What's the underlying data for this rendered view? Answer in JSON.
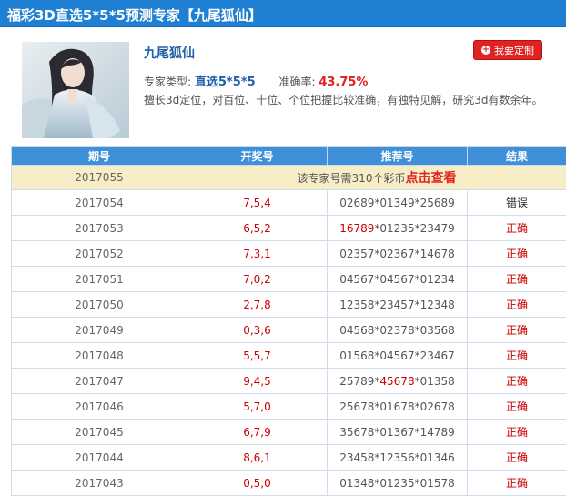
{
  "header": {
    "title": "福彩3D直选5*5*5预测专家【九尾狐仙】"
  },
  "expert": {
    "name": "九尾狐仙",
    "custom_button": "我要定制",
    "type_label": "专家类型:",
    "type_value": "直选5*5*5",
    "accuracy_label": "准确率:",
    "accuracy_value": "43.75%",
    "description": "擅长3d定位，对百位、十位、个位把握比较准确，有独特见解，研究3d有数余年。"
  },
  "table": {
    "headers": [
      "期号",
      "开奖号",
      "推荐号",
      "结果"
    ],
    "locked": {
      "period": "2017055",
      "text": "该专家号需310个彩币",
      "link": "点击查看"
    },
    "rows": [
      {
        "period": "2017054",
        "draw": "7,5,4",
        "rec": [
          {
            "t": "02689",
            "r": false
          },
          {
            "t": "*",
            "r": false
          },
          {
            "t": "01349",
            "r": false
          },
          {
            "t": "*",
            "r": false
          },
          {
            "t": "25689",
            "r": false
          }
        ],
        "result": "错误",
        "ok": false
      },
      {
        "period": "2017053",
        "draw": "6,5,2",
        "rec": [
          {
            "t": "16789",
            "r": true
          },
          {
            "t": "*",
            "r": false
          },
          {
            "t": "01235",
            "r": false
          },
          {
            "t": "*",
            "r": false
          },
          {
            "t": "23479",
            "r": false
          }
        ],
        "result": "正确",
        "ok": true
      },
      {
        "period": "2017052",
        "draw": "7,3,1",
        "rec": [
          {
            "t": "02357",
            "r": false
          },
          {
            "t": "*",
            "r": false
          },
          {
            "t": "02367",
            "r": false
          },
          {
            "t": "*",
            "r": false
          },
          {
            "t": "14678",
            "r": false
          }
        ],
        "result": "正确",
        "ok": true
      },
      {
        "period": "2017051",
        "draw": "7,0,2",
        "rec": [
          {
            "t": "04567",
            "r": false
          },
          {
            "t": "*",
            "r": false
          },
          {
            "t": "04567",
            "r": false
          },
          {
            "t": "*",
            "r": false
          },
          {
            "t": "01234",
            "r": false
          }
        ],
        "result": "正确",
        "ok": true
      },
      {
        "period": "2017050",
        "draw": "2,7,8",
        "rec": [
          {
            "t": "12358",
            "r": false
          },
          {
            "t": "*",
            "r": false
          },
          {
            "t": "23457",
            "r": false
          },
          {
            "t": "*",
            "r": false
          },
          {
            "t": "12348",
            "r": false
          }
        ],
        "result": "正确",
        "ok": true
      },
      {
        "period": "2017049",
        "draw": "0,3,6",
        "rec": [
          {
            "t": "04568",
            "r": false
          },
          {
            "t": "*",
            "r": false
          },
          {
            "t": "02378",
            "r": false
          },
          {
            "t": "*",
            "r": false
          },
          {
            "t": "03568",
            "r": false
          }
        ],
        "result": "正确",
        "ok": true
      },
      {
        "period": "2017048",
        "draw": "5,5,7",
        "rec": [
          {
            "t": "01568",
            "r": false
          },
          {
            "t": "*",
            "r": false
          },
          {
            "t": "04567",
            "r": false
          },
          {
            "t": "*",
            "r": false
          },
          {
            "t": "23467",
            "r": false
          }
        ],
        "result": "正确",
        "ok": true
      },
      {
        "period": "2017047",
        "draw": "9,4,5",
        "rec": [
          {
            "t": "25789",
            "r": false
          },
          {
            "t": "*",
            "r": false
          },
          {
            "t": "45678",
            "r": true
          },
          {
            "t": "*",
            "r": false
          },
          {
            "t": "01358",
            "r": false
          }
        ],
        "result": "正确",
        "ok": true
      },
      {
        "period": "2017046",
        "draw": "5,7,0",
        "rec": [
          {
            "t": "25678",
            "r": false
          },
          {
            "t": "*",
            "r": false
          },
          {
            "t": "01678",
            "r": false
          },
          {
            "t": "*",
            "r": false
          },
          {
            "t": "02678",
            "r": false
          }
        ],
        "result": "正确",
        "ok": true
      },
      {
        "period": "2017045",
        "draw": "6,7,9",
        "rec": [
          {
            "t": "35678",
            "r": false
          },
          {
            "t": "*",
            "r": false
          },
          {
            "t": "01367",
            "r": false
          },
          {
            "t": "*",
            "r": false
          },
          {
            "t": "14789",
            "r": false
          }
        ],
        "result": "正确",
        "ok": true
      },
      {
        "period": "2017044",
        "draw": "8,6,1",
        "rec": [
          {
            "t": "23458",
            "r": false
          },
          {
            "t": "*",
            "r": false
          },
          {
            "t": "12356",
            "r": false
          },
          {
            "t": "*",
            "r": false
          },
          {
            "t": "01346",
            "r": false
          }
        ],
        "result": "正确",
        "ok": true
      },
      {
        "period": "2017043",
        "draw": "0,5,0",
        "rec": [
          {
            "t": "01348",
            "r": false
          },
          {
            "t": "*",
            "r": false
          },
          {
            "t": "01235",
            "r": false
          },
          {
            "t": "*",
            "r": false
          },
          {
            "t": "01578",
            "r": false
          }
        ],
        "result": "正确",
        "ok": true
      }
    ]
  }
}
